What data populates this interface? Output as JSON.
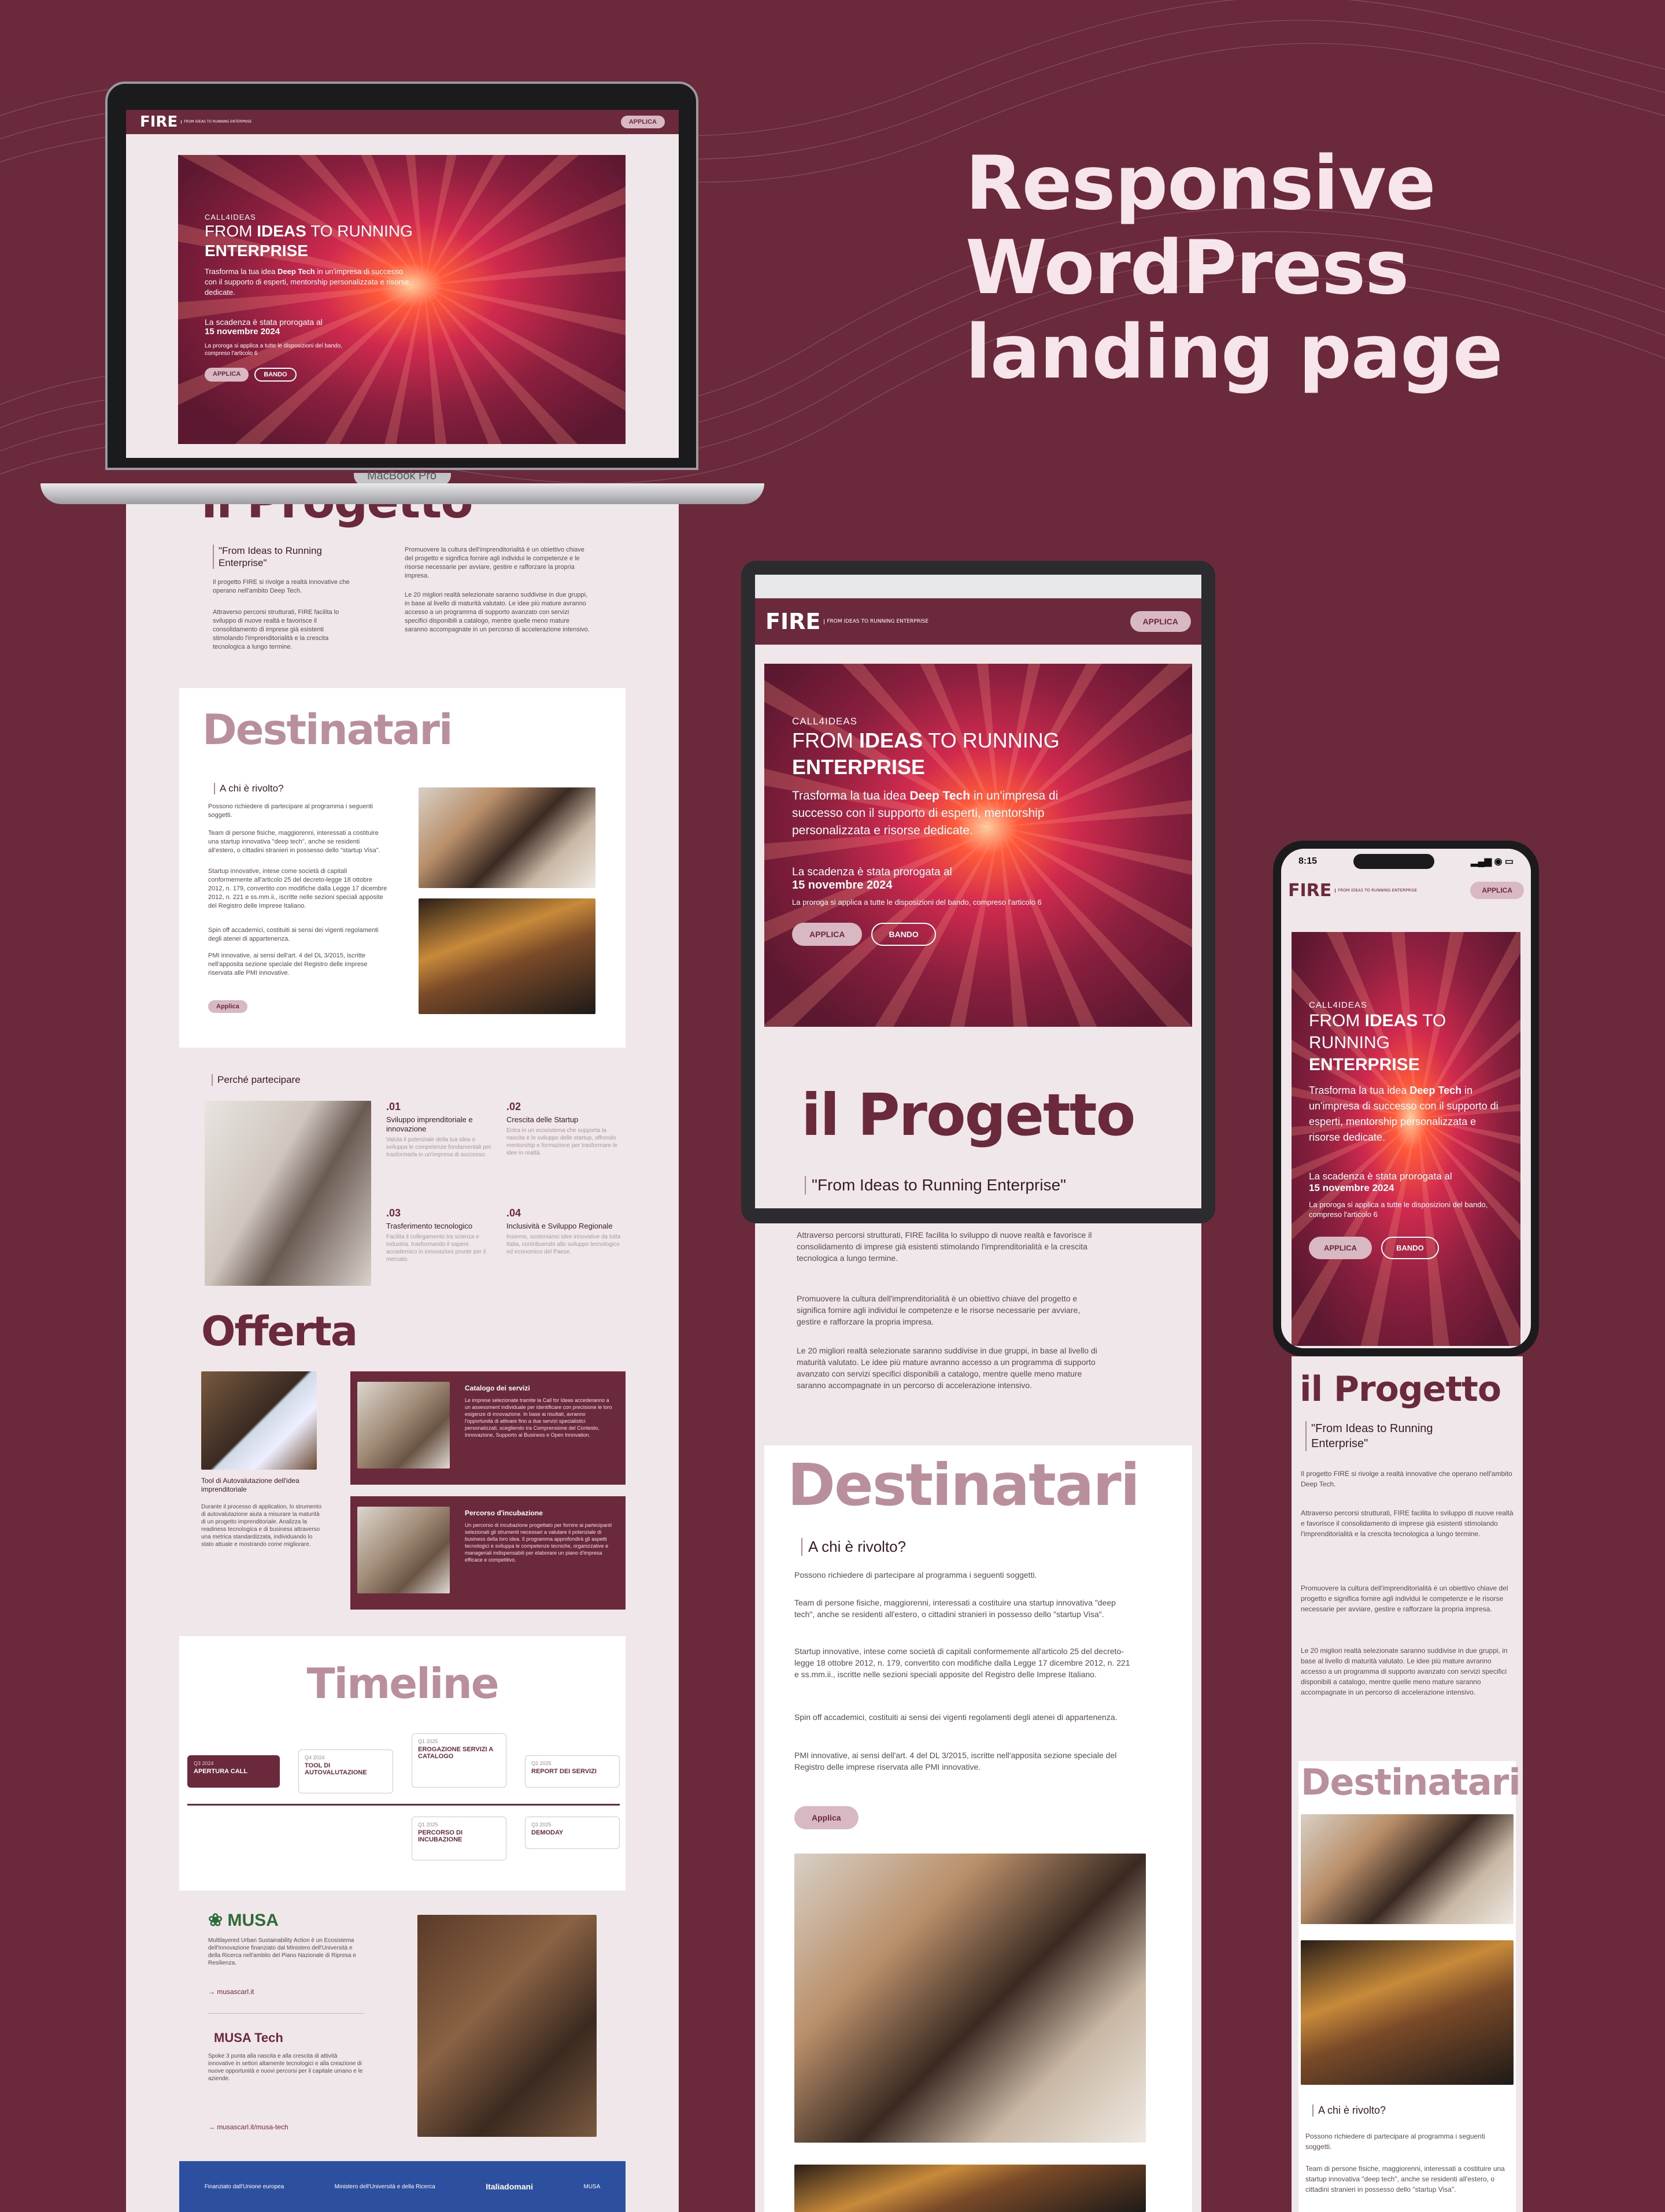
{
  "headline": [
    "Responsive",
    "WordPress",
    "landing page"
  ],
  "brand": {
    "logo": "FIRE",
    "logo_sub": "FROM IDEAS TO RUNNING ENTERPRISE"
  },
  "nav": {
    "apply": "APPLICA"
  },
  "hero": {
    "kicker": "CALL4IDEAS",
    "title_a": "FROM ",
    "title_b": "IDEAS",
    "title_c": " TO RUNNING ",
    "title_d": "ENTERPRISE",
    "desc_a": "Trasforma la tua idea ",
    "desc_b": "Deep Tech",
    "desc_c": " in un'impresa di successo con il supporto di esperti, mentorship personalizzata e risorse dedicate.",
    "deadline": "La scadenza è stata prorogata al",
    "deadline_date": "15 novembre 2024",
    "note": "La proroga si applica a tutte le disposizioni del bando, compreso l'articolo 6",
    "btn_apply": "APPLICA",
    "btn_bando": "BANDO"
  },
  "laptop_label": "MacBook Pro",
  "progetto": {
    "title": "il Progetto",
    "quote": "\"From Ideas to Running Enterprise\"",
    "p1": "Il progetto FIRE si rivolge a realtà innovative che operano nell'ambito Deep Tech.",
    "p2": "Attraverso percorsi strutturati, FIRE facilita lo sviluppo di nuove realtà e favorisce il consolidamento di imprese già esistenti stimolando l'imprenditorialità e la crescita tecnologica a lungo termine.",
    "p3": "Promuovere la cultura dell'imprenditorialità è un obiettivo chiave del progetto e significa fornire agli individui le competenze e le risorse necessarie per avviare, gestire e rafforzare la propria impresa.",
    "p4": "Le 20 migliori realtà selezionate saranno suddivise in due gruppi, in base al livello di maturità valutato. Le idee più mature avranno accesso a un programma di supporto avanzato con servizi specifici disponibili a catalogo, mentre quelle meno mature saranno accompagnate in un percorso di accelerazione intensivo."
  },
  "destinatari": {
    "title": "Destinatari",
    "question": "A chi è rivolto?",
    "intro": "Possono richiedere di partecipare al programma i seguenti soggetti.",
    "items": [
      "Team di persone fisiche, maggiorenni, interessati a costituire una startup innovativa \"deep tech\", anche se residenti all'estero, o cittadini stranieri in possesso dello \"startup Visa\".",
      "Startup innovative, intese come società di capitali conformemente all'articolo 25 del decreto-legge 18 ottobre 2012, n. 179, convertito con modifiche dalla Legge 17 dicembre 2012, n. 221 e ss.mm.ii., iscritte nelle sezioni speciali apposite del Registro delle Imprese Italiano.",
      "Spin off accademici, costituiti ai sensi dei vigenti regolamenti degli atenei di appartenenza.",
      "PMI innovative, ai sensi dell'art. 4 del DL 3/2015, iscritte nell'apposita sezione speciale del Registro delle imprese riservata alle PMI innovative."
    ],
    "btn": "Applica"
  },
  "perche": {
    "label": "Perché partecipare",
    "items": [
      {
        "n": ".01",
        "t": "Sviluppo imprenditoriale e innovazione",
        "d": "Valuta il potenziale della tua idea o sviluppa le competenze fondamentali per trasformarla in un'impresa di successo."
      },
      {
        "n": ".02",
        "t": "Crescita delle Startup",
        "d": "Entra in un ecosistema che supporta la nascita e lo sviluppo delle startup, offrendo mentorship e formazione per trasformare le idee in realtà."
      },
      {
        "n": ".03",
        "t": "Trasferimento tecnologico",
        "d": "Facilita il collegamento tra scienza e industria, trasformando il sapere accademico in innovazioni pronte per il mercato."
      },
      {
        "n": ".04",
        "t": "Inclusività e Sviluppo Regionale",
        "d": "Insieme, sosteniamo idee innovative da tutta Italia, contribuendo allo sviluppo tecnologico ed economico del Paese."
      }
    ]
  },
  "offerta": {
    "title": "Offerta",
    "tool_title": "Tool di Autovalutazione dell'idea imprenditoriale",
    "tool_desc": "Durante il processo di application, lo strumento di autovalutazione aiuta a misurare la maturità di un progetto imprenditoriale. Analizza la readiness tecnologica e di business attraverso una metrica standardizzata, individuando lo stato attuale e mostrando come migliorare.",
    "card1_title": "Catalogo dei servizi",
    "card1_desc": "Le imprese selezionate tramite la Call for Ideas accederanno a un assessment individuale per identificare con precisione le loro esigenze di innovazione. In base ai risultati, avranno l'opportunità di attivare fino a due servizi specialistici personalizzati, scegliendo tra Comprensione del Contesto, Innovazione, Supporto al Business e Open Innovation.",
    "card2_title": "Percorso d'incubazione",
    "card2_desc": "Un percorso di incubazione progettato per fornire ai partecipanti selezionati gli strumenti necessari a valutare il potenziale di business della loro idea. Il programma approfondirà gli aspetti tecnologici e sviluppa le competenze tecniche, organizzative e manageriali indispensabili per elaborare un piano d'impresa efficace e competitivo."
  },
  "timeline": {
    "title": "Timeline",
    "items": [
      {
        "date": "Q3 2024",
        "label": "APERTURA CALL"
      },
      {
        "date": "Q4 2024",
        "label": "TOOL DI AUTOVALUTAZIONE"
      },
      {
        "date": "Q1 2025",
        "label": "EROGAZIONE SERVIZI A CATALOGO"
      },
      {
        "date": "Q2 2025",
        "label": "REPORT DEI SERVIZI"
      },
      {
        "date": "Q1 2025",
        "label": "PERCORSO DI INCUBAZIONE"
      },
      {
        "date": "Q3 2025",
        "label": "DEMODAY"
      }
    ]
  },
  "partners": {
    "musa": "MUSA",
    "musa_desc": "Multilayered Urban Sustainability Action è un Ecosistema dell'Innovazione finanziato dal Ministero dell'Università e della Ricerca nell'ambito del Piano Nazionale di Ripresa e Resilienza.",
    "musa_link": "→ musascarl.it",
    "musatech": "MUSA Tech",
    "musatech_desc": "Spoke 3 punta alla nascita e alla crescita di attività innovative in settori altamente tecnologici e alla creazione di nuove opportunità e nuovi percorsi per il capitale umano e le aziende.",
    "musatech_link": "→ musascarl.it/musa-tech"
  },
  "footer_logos": [
    "Finanziato dall'Unione europea",
    "Ministero dell'Università e della Ricerca",
    "Italiadomani",
    "MUSA"
  ],
  "phone_time": "8:15"
}
